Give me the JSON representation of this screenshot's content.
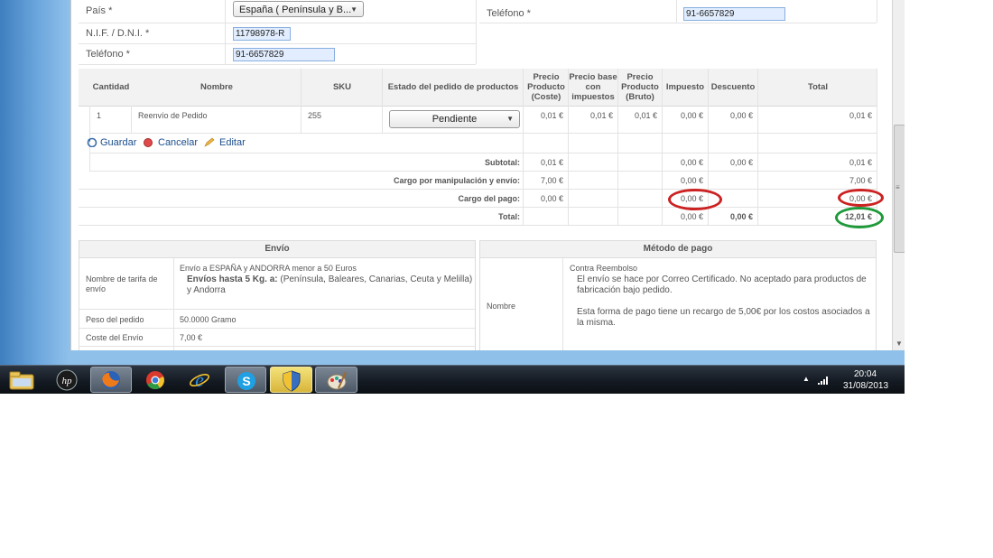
{
  "form": {
    "pais_label": "País *",
    "pais_value": "España ( Península y B...",
    "nif_label": "N.I.F. / D.N.I. *",
    "nif_value": "11798978-R",
    "telefono_label": "Teléfono *",
    "telefono_value": "91-6657829",
    "telefono2_label": "Teléfono *",
    "telefono2_value": "91-6657829"
  },
  "products_table": {
    "headers": [
      "Cantidad",
      "Nombre",
      "SKU",
      "Estado del pedido de productos",
      "Precio Producto (Coste)",
      "Precio base con impuestos",
      "Precio Producto (Bruto)",
      "Impuesto",
      "Descuento",
      "Total"
    ],
    "row": {
      "cantidad": "1",
      "nombre": "Reenvío de Pedido",
      "sku": "255",
      "estado": "Pendiente",
      "coste": "0,01 €",
      "base": "0,01 €",
      "bruto": "0,01 €",
      "impuesto": "0,00 €",
      "descuento": "0,00 €",
      "total": "0,01 €"
    }
  },
  "actions": {
    "guardar": "Guardar",
    "cancelar": "Cancelar",
    "editar": "Editar"
  },
  "summary": [
    {
      "label": "Subtotal:",
      "coste": "0,01 €",
      "impuesto": "0,00 €",
      "descuento": "0,00 €",
      "total": "0,01 €"
    },
    {
      "label": "Cargo por manipulación y envío:",
      "coste": "7,00 €",
      "impuesto": "0,00 €",
      "descuento": "",
      "total": "7,00 €"
    },
    {
      "label": "Cargo del pago:",
      "coste": "0,00 €",
      "impuesto": "0,00 €",
      "descuento": "",
      "total": "0,00 €"
    },
    {
      "label": "Total:",
      "coste": "",
      "impuesto": "0,00 €",
      "descuento": "0,00 €",
      "total": "12,01 €"
    }
  ],
  "envio": {
    "title": "Envío",
    "rows": [
      {
        "label": "Nombre de tarifa de envío",
        "value": "Envío a ESPAÑA y ANDORRA menor a 50 Euros",
        "value_bold": "Envíos hasta 5 Kg. a:",
        "value_rest": "(Península, Baleares, Canarias, Ceuta y Melilla) y Andorra"
      },
      {
        "label": "Peso del pedido",
        "value": "50.0000 Gramo"
      },
      {
        "label": "Coste del Envío",
        "value": "7,00 €"
      }
    ]
  },
  "pago": {
    "title": "Método de pago",
    "label": "Nombre",
    "method": "Contra Reembolso",
    "desc1": "El envío se hace por Correo Certificado.  No aceptado para productos de fabricación bajo pedido.",
    "desc2": "Esta forma de pago tiene un recargo de 5,00€ por los costos asociados a la misma."
  },
  "taskbar": {
    "time": "20:04",
    "date": "31/08/2013"
  },
  "colors": {
    "red_highlight": "#cc2222",
    "green_highlight": "#1e9a3a",
    "field_bg": "#e2eeff"
  }
}
